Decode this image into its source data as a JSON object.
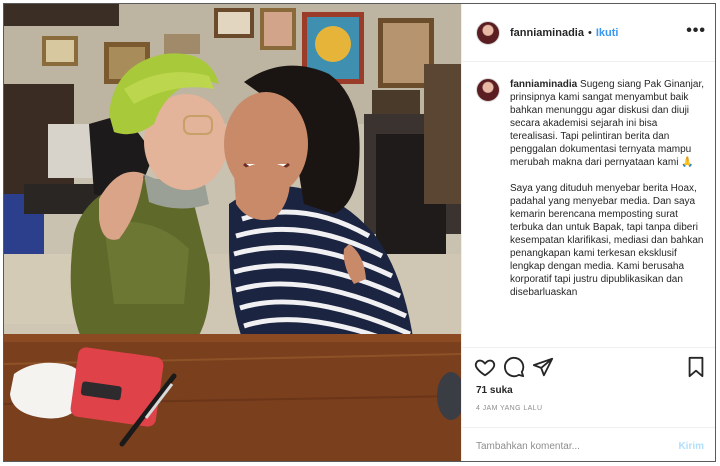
{
  "post": {
    "username": "fanniaminadia",
    "follow_label": "Ikuti",
    "separator": "•",
    "more_label": "•••"
  },
  "caption": {
    "username": "fanniaminadia",
    "paragraph_1": "Sugeng siang Pak Ginanjar, prinsipnya kami sangat menyambut baik bahkan menunggu agar diskusi dan diuji secara akademisi sejarah ini bisa terealisasi. Tapi pelintiran berita dan penggalan dokumentasi ternyata mampu merubah makna dari pernyataan kami 🙏",
    "paragraph_2": "Saya yang dituduh menyebar berita Hoax, padahal yang menyebar media. Dan saya kemarin berencana memposting surat terbuka dan untuk Bapak, tapi tanpa diberi kesempatan klarifikasi, mediasi dan bahkan penangkapan kami terkesan eksklusif lengkap dengan media. Kami berusaha korporatif tapi justru dipublikasikan dan disebarluaskan"
  },
  "icons": {
    "like": "heart-icon",
    "comment": "comment-icon",
    "share": "share-icon",
    "save": "bookmark-icon"
  },
  "stats": {
    "likes": "71 suka",
    "timestamp": "4 JAM YANG LALU"
  },
  "comment": {
    "placeholder": "Tambahkan komentar...",
    "send_label": "Kirim"
  },
  "colors": {
    "link_blue": "#3897f0",
    "send_disabled": "#b2dffc",
    "muted": "#8e8e8e"
  }
}
